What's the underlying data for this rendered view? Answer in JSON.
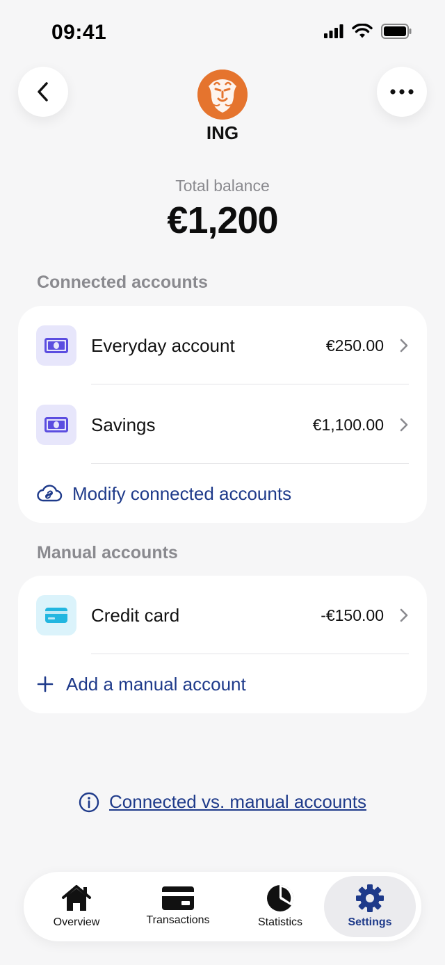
{
  "status_bar": {
    "time": "09:41"
  },
  "header": {
    "bank_name": "ING"
  },
  "balance": {
    "label": "Total balance",
    "value": "€1,200"
  },
  "connected": {
    "title": "Connected accounts",
    "accounts": [
      {
        "label": "Everyday account",
        "amount": "€250.00",
        "icon": "banknote-icon"
      },
      {
        "label": "Savings",
        "amount": "€1,100.00",
        "icon": "banknote-icon"
      }
    ],
    "modify_label": "Modify connected accounts"
  },
  "manual": {
    "title": "Manual accounts",
    "accounts": [
      {
        "label": "Credit card",
        "amount": "-€150.00",
        "icon": "credit-card-icon"
      }
    ],
    "add_label": "Add a manual account"
  },
  "info_link": "Connected vs. manual accounts",
  "nav": {
    "tabs": [
      {
        "label": "Overview",
        "icon": "home-icon"
      },
      {
        "label": "Transactions",
        "icon": "card-icon"
      },
      {
        "label": "Statistics",
        "icon": "pie-chart-icon"
      },
      {
        "label": "Settings",
        "icon": "gear-icon",
        "active": true
      }
    ]
  },
  "colors": {
    "accent": "#1e3a8a",
    "brand": "#e5742e",
    "background": "#f6f6f7"
  }
}
